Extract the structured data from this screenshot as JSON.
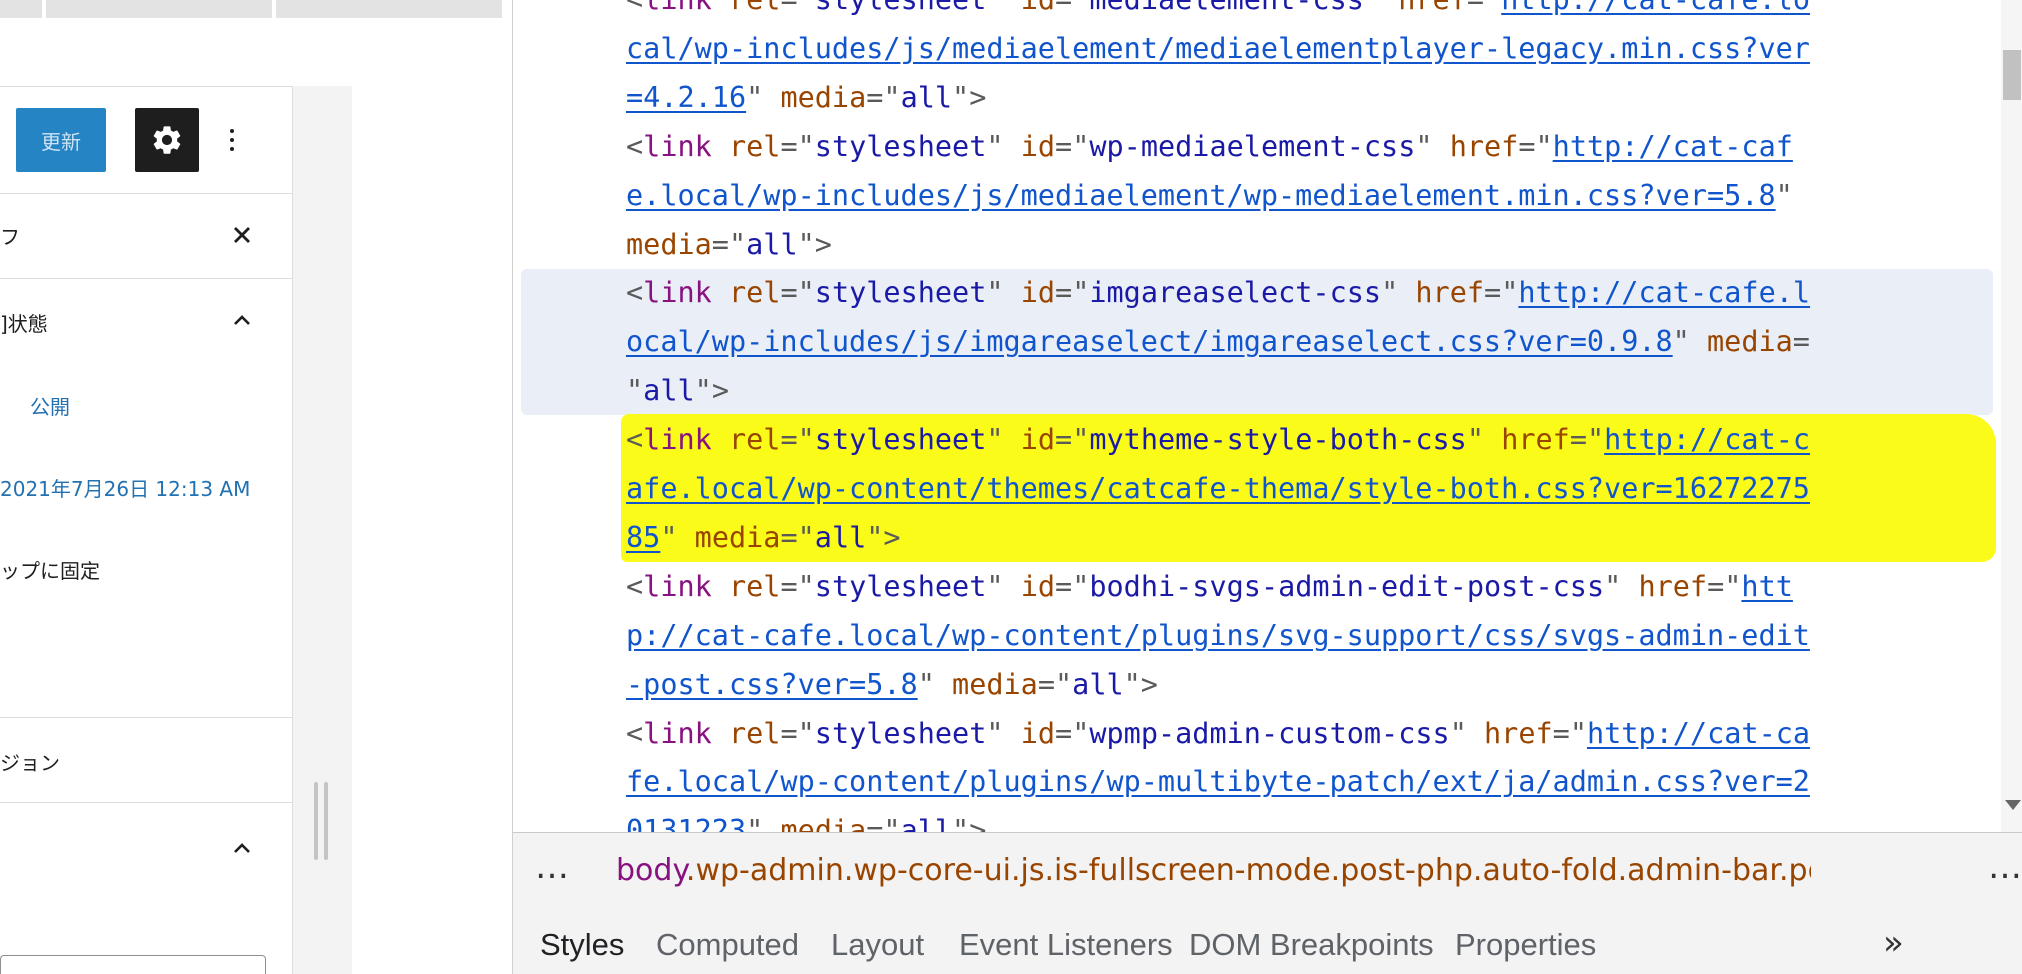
{
  "wp": {
    "update_label": "更新",
    "close_label": "✕",
    "rows": {
      "tab_fragment": "フ",
      "status_heading": "]状態",
      "visibility_value": "公開",
      "date_value": "2021年7月26日 12:13 AM",
      "sticky_label": "ップに固定",
      "revision_label": "ジョン"
    }
  },
  "devtools": {
    "lines": [
      {
        "segments": [
          [
            "p",
            "<"
          ],
          [
            "t",
            "link"
          ],
          [
            "a",
            " rel"
          ],
          [
            "p",
            "=\""
          ],
          [
            "v",
            "stylesheet"
          ],
          [
            "p",
            "\""
          ],
          [
            "a",
            " id"
          ],
          [
            "p",
            "=\""
          ],
          [
            "v",
            "mediaelement-css"
          ],
          [
            "p",
            "\""
          ],
          [
            "a",
            " href"
          ],
          [
            "p",
            "=\""
          ],
          [
            "u",
            "http://cat-cafe.lo"
          ]
        ]
      },
      {
        "segments": [
          [
            "u",
            "cal/wp-includes/js/mediaelement/mediaelementplayer-legacy.min.css?ver"
          ]
        ]
      },
      {
        "segments": [
          [
            "u",
            "=4.2.16"
          ],
          [
            "p",
            "\""
          ],
          [
            "a",
            " media"
          ],
          [
            "p",
            "=\""
          ],
          [
            "v",
            "all"
          ],
          [
            "p",
            "\">"
          ]
        ]
      },
      {
        "segments": [
          [
            "p",
            "<"
          ],
          [
            "t",
            "link"
          ],
          [
            "a",
            " rel"
          ],
          [
            "p",
            "=\""
          ],
          [
            "v",
            "stylesheet"
          ],
          [
            "p",
            "\""
          ],
          [
            "a",
            " id"
          ],
          [
            "p",
            "=\""
          ],
          [
            "v",
            "wp-mediaelement-css"
          ],
          [
            "p",
            "\""
          ],
          [
            "a",
            " href"
          ],
          [
            "p",
            "=\""
          ],
          [
            "u",
            "http://cat-caf"
          ]
        ]
      },
      {
        "segments": [
          [
            "u",
            "e.local/wp-includes/js/mediaelement/wp-mediaelement.min.css?ver=5.8"
          ],
          [
            "p",
            "\""
          ]
        ]
      },
      {
        "segments": [
          [
            "a",
            "media"
          ],
          [
            "p",
            "=\""
          ],
          [
            "v",
            "all"
          ],
          [
            "p",
            "\">"
          ]
        ]
      },
      {
        "segments": [
          [
            "p",
            "<"
          ],
          [
            "t",
            "link"
          ],
          [
            "a",
            " rel"
          ],
          [
            "p",
            "=\""
          ],
          [
            "v",
            "stylesheet"
          ],
          [
            "p",
            "\""
          ],
          [
            "a",
            " id"
          ],
          [
            "p",
            "=\""
          ],
          [
            "v",
            "imgareaselect-css"
          ],
          [
            "p",
            "\""
          ],
          [
            "a",
            " href"
          ],
          [
            "p",
            "=\""
          ],
          [
            "u",
            "http://cat-cafe.l"
          ]
        ]
      },
      {
        "segments": [
          [
            "u",
            "ocal/wp-includes/js/imgareaselect/imgareaselect.css?ver=0.9.8"
          ],
          [
            "p",
            "\""
          ],
          [
            "a",
            " media"
          ],
          [
            "p",
            "="
          ]
        ]
      },
      {
        "segments": [
          [
            "p",
            "\""
          ],
          [
            "v",
            "all"
          ],
          [
            "p",
            "\">"
          ]
        ]
      },
      {
        "segments": [
          [
            "p",
            "<"
          ],
          [
            "t",
            "link"
          ],
          [
            "a",
            " rel"
          ],
          [
            "p",
            "=\""
          ],
          [
            "v",
            "stylesheet"
          ],
          [
            "p",
            "\""
          ],
          [
            "a",
            " id"
          ],
          [
            "p",
            "=\""
          ],
          [
            "v",
            "mytheme-style-both-css"
          ],
          [
            "p",
            "\""
          ],
          [
            "a",
            " href"
          ],
          [
            "p",
            "=\""
          ],
          [
            "u",
            "http://cat-c"
          ]
        ]
      },
      {
        "segments": [
          [
            "u",
            "afe.local/wp-content/themes/catcafe-thema/style-both.css?ver=16272275"
          ]
        ]
      },
      {
        "segments": [
          [
            "u",
            "85"
          ],
          [
            "p",
            "\""
          ],
          [
            "a",
            " media"
          ],
          [
            "p",
            "=\""
          ],
          [
            "v",
            "all"
          ],
          [
            "p",
            "\">"
          ]
        ]
      },
      {
        "segments": [
          [
            "p",
            "<"
          ],
          [
            "t",
            "link"
          ],
          [
            "a",
            " rel"
          ],
          [
            "p",
            "=\""
          ],
          [
            "v",
            "stylesheet"
          ],
          [
            "p",
            "\""
          ],
          [
            "a",
            " id"
          ],
          [
            "p",
            "=\""
          ],
          [
            "v",
            "bodhi-svgs-admin-edit-post-css"
          ],
          [
            "p",
            "\""
          ],
          [
            "a",
            " href"
          ],
          [
            "p",
            "=\""
          ],
          [
            "u",
            "htt"
          ]
        ]
      },
      {
        "segments": [
          [
            "u",
            "p://cat-cafe.local/wp-content/plugins/svg-support/css/svgs-admin-edit"
          ]
        ]
      },
      {
        "segments": [
          [
            "u",
            "-post.css?ver=5.8"
          ],
          [
            "p",
            "\""
          ],
          [
            "a",
            " media"
          ],
          [
            "p",
            "=\""
          ],
          [
            "v",
            "all"
          ],
          [
            "p",
            "\">"
          ]
        ]
      },
      {
        "segments": [
          [
            "p",
            "<"
          ],
          [
            "t",
            "link"
          ],
          [
            "a",
            " rel"
          ],
          [
            "p",
            "=\""
          ],
          [
            "v",
            "stylesheet"
          ],
          [
            "p",
            "\""
          ],
          [
            "a",
            " id"
          ],
          [
            "p",
            "=\""
          ],
          [
            "v",
            "wpmp-admin-custom-css"
          ],
          [
            "p",
            "\""
          ],
          [
            "a",
            " href"
          ],
          [
            "p",
            "=\""
          ],
          [
            "u",
            "http://cat-ca"
          ]
        ]
      },
      {
        "segments": [
          [
            "u",
            "fe.local/wp-content/plugins/wp-multibyte-patch/ext/ja/admin.css?ver=2"
          ]
        ]
      },
      {
        "segments": [
          [
            "u",
            "0131223"
          ],
          [
            "p",
            "\""
          ],
          [
            "a",
            " media"
          ],
          [
            "p",
            "=\""
          ],
          [
            "v",
            "all"
          ],
          [
            "p",
            "\">"
          ]
        ]
      }
    ],
    "breadcrumb": {
      "dots": "…",
      "tag": "body",
      "classes": ".wp-admin.wp-core-ui.js.is-fullscreen-mode.post-php.auto-fold.admin-bar.post-t"
    },
    "tabs": [
      "Styles",
      "Computed",
      "Layout",
      "Event Listeners",
      "DOM Breakpoints",
      "Properties"
    ],
    "tabs_more": "»"
  }
}
